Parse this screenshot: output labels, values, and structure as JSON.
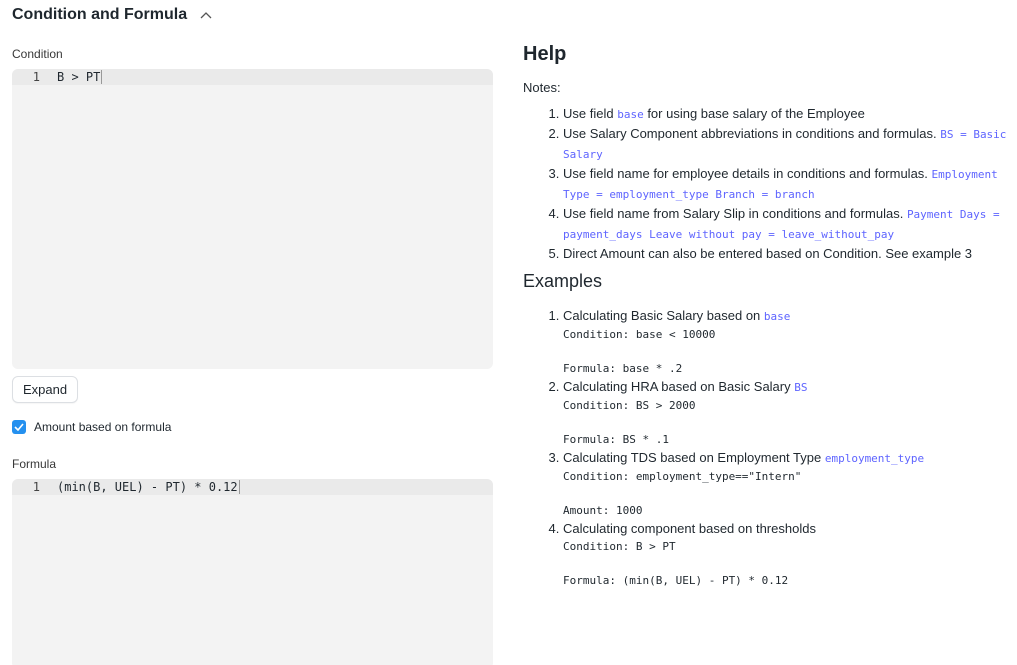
{
  "section": {
    "title": "Condition and Formula"
  },
  "condition": {
    "label": "Condition",
    "line_number": "1",
    "code": "B > PT"
  },
  "expand_button": "Expand",
  "amount_based": {
    "label": "Amount based on formula",
    "checked": true
  },
  "formula": {
    "label": "Formula",
    "line_number": "1",
    "code": "(min(B, UEL) - PT) * 0.12"
  },
  "help": {
    "title": "Help",
    "notes_title": "Notes:",
    "notes": [
      {
        "text": "Use field ",
        "code": "base",
        "text2": " for using base salary of the Employee"
      },
      {
        "text": "Use Salary Component abbreviations in conditions and formulas. ",
        "code": "BS = Basic Salary"
      },
      {
        "text": "Use field name for employee details in conditions and formulas. ",
        "code": "Employment Type = employment_type Branch = branch"
      },
      {
        "text": "Use field name from Salary Slip in conditions and formulas. ",
        "code": "Payment Days = payment_days Leave without pay = leave_without_pay"
      },
      {
        "text": "Direct Amount can also be entered based on Condition. See example 3"
      }
    ],
    "examples_title": "Examples",
    "examples": [
      {
        "text": "Calculating Basic Salary based on ",
        "code": "base",
        "line1": "Condition: base < 10000",
        "line2": "Formula: base * .2"
      },
      {
        "text": "Calculating HRA based on Basic Salary ",
        "code": "BS",
        "line1": "Condition: BS > 2000",
        "line2": "Formula: BS * .1"
      },
      {
        "text": "Calculating TDS based on Employment Type ",
        "code": "employment_type",
        "line1": "Condition: employment_type==\"Intern\"",
        "line2": "Amount: 1000"
      },
      {
        "text": "Calculating component based on thresholds",
        "code": "",
        "line1": "Condition: B > PT",
        "line2": "Formula: (min(B, UEL) - PT) * 0.12"
      }
    ]
  }
}
